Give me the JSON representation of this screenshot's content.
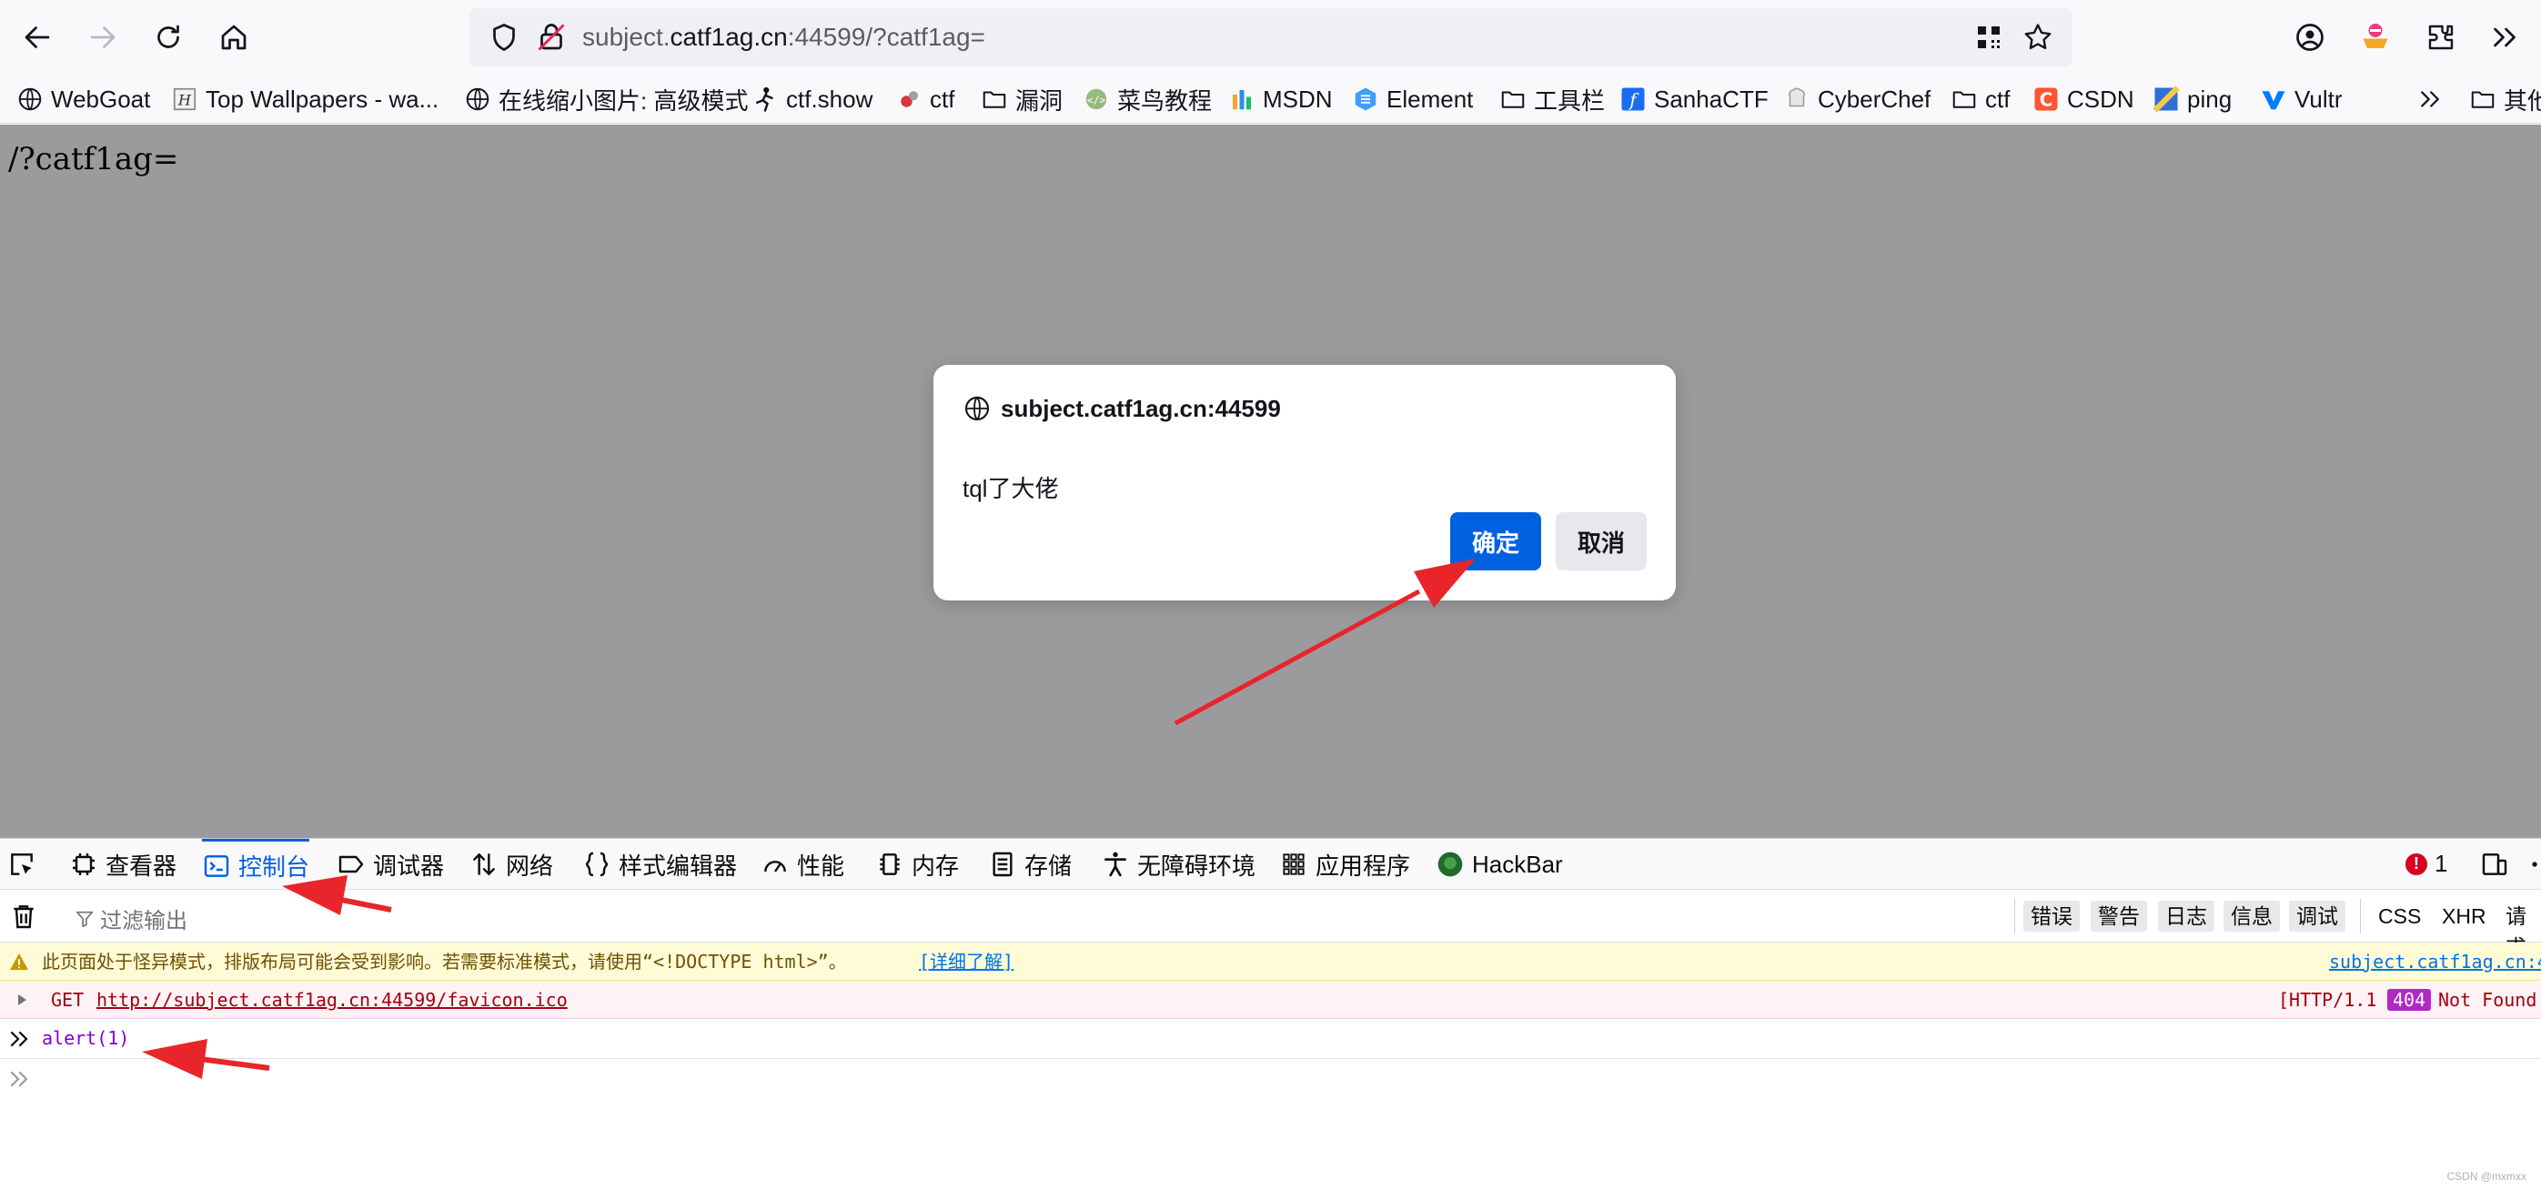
{
  "toolbar": {
    "url_prefix": "subject.",
    "url_host": "catf1ag.cn",
    "url_suffix": ":44599/?catf1ag="
  },
  "bookmarks": [
    {
      "label": "WebGoat",
      "icon": "globe-icon"
    },
    {
      "label": "Top Wallpapers - wa...",
      "icon": "wallpaper-icon"
    },
    {
      "label": "在线缩小图片: 高级模式",
      "icon": "globe-icon"
    },
    {
      "label": "ctf.show",
      "icon": "runner-icon"
    },
    {
      "label": "ctf",
      "icon": "ctf-icon"
    },
    {
      "label": "漏洞",
      "icon": "folder-icon"
    },
    {
      "label": "菜鸟教程",
      "icon": "runoob-icon"
    },
    {
      "label": "MSDN",
      "icon": "msdn-icon"
    },
    {
      "label": "Element",
      "icon": "element-icon"
    },
    {
      "label": "工具栏",
      "icon": "folder-icon"
    },
    {
      "label": "SanhaCTF",
      "icon": "sanha-icon"
    },
    {
      "label": "CyberChef",
      "icon": "chef-icon"
    },
    {
      "label": "ctf",
      "icon": "folder-icon"
    },
    {
      "label": "CSDN",
      "icon": "csdn-icon"
    },
    {
      "label": "ping",
      "icon": "ping-icon"
    },
    {
      "label": "Vultr",
      "icon": "vultr-icon"
    },
    {
      "label": "其他",
      "icon": "folder-icon"
    }
  ],
  "page": {
    "text": "/?catf1ag="
  },
  "dialog": {
    "origin": "subject.catf1ag.cn:44599",
    "message": "tql了大佬",
    "ok_label": "确定",
    "cancel_label": "取消"
  },
  "devtools": {
    "tabs": [
      {
        "label": "查看器",
        "icon": "inspector-icon"
      },
      {
        "label": "控制台",
        "icon": "console-icon",
        "active": true
      },
      {
        "label": "调试器",
        "icon": "debugger-icon"
      },
      {
        "label": "网络",
        "icon": "network-icon"
      },
      {
        "label": "样式编辑器",
        "icon": "style-editor-icon"
      },
      {
        "label": "性能",
        "icon": "performance-icon"
      },
      {
        "label": "内存",
        "icon": "memory-icon"
      },
      {
        "label": "存储",
        "icon": "storage-icon"
      },
      {
        "label": "无障碍环境",
        "icon": "accessibility-icon"
      },
      {
        "label": "应用程序",
        "icon": "application-icon"
      },
      {
        "label": "HackBar",
        "icon": "hackbar-icon"
      }
    ],
    "error_count": "1",
    "filter_placeholder": "过滤输出",
    "filters": [
      "错误",
      "警告",
      "日志",
      "信息",
      "调试",
      "CSS",
      "XHR",
      "请求"
    ],
    "messages": {
      "warning_text": "此页面处于怪异模式，排版布局可能会受到影响。若需要标准模式，请使用“<!DOCTYPE html>”。",
      "warning_link": "[详细了解]",
      "warning_source": "subject.catf1ag.cn:4",
      "error_method": "GET",
      "error_url": "http://subject.catf1ag.cn:44599/favicon.ico",
      "error_status_prefix": "[HTTP/1.1",
      "error_status_code": "404",
      "error_status_text": "Not Found",
      "input_command": "alert(1)"
    }
  },
  "watermark": "CSDN @mxmxx",
  "colors": {
    "accent": "#0061e0",
    "annotation_arrow": "#e8252a",
    "overlay": "#9b9b9d"
  }
}
